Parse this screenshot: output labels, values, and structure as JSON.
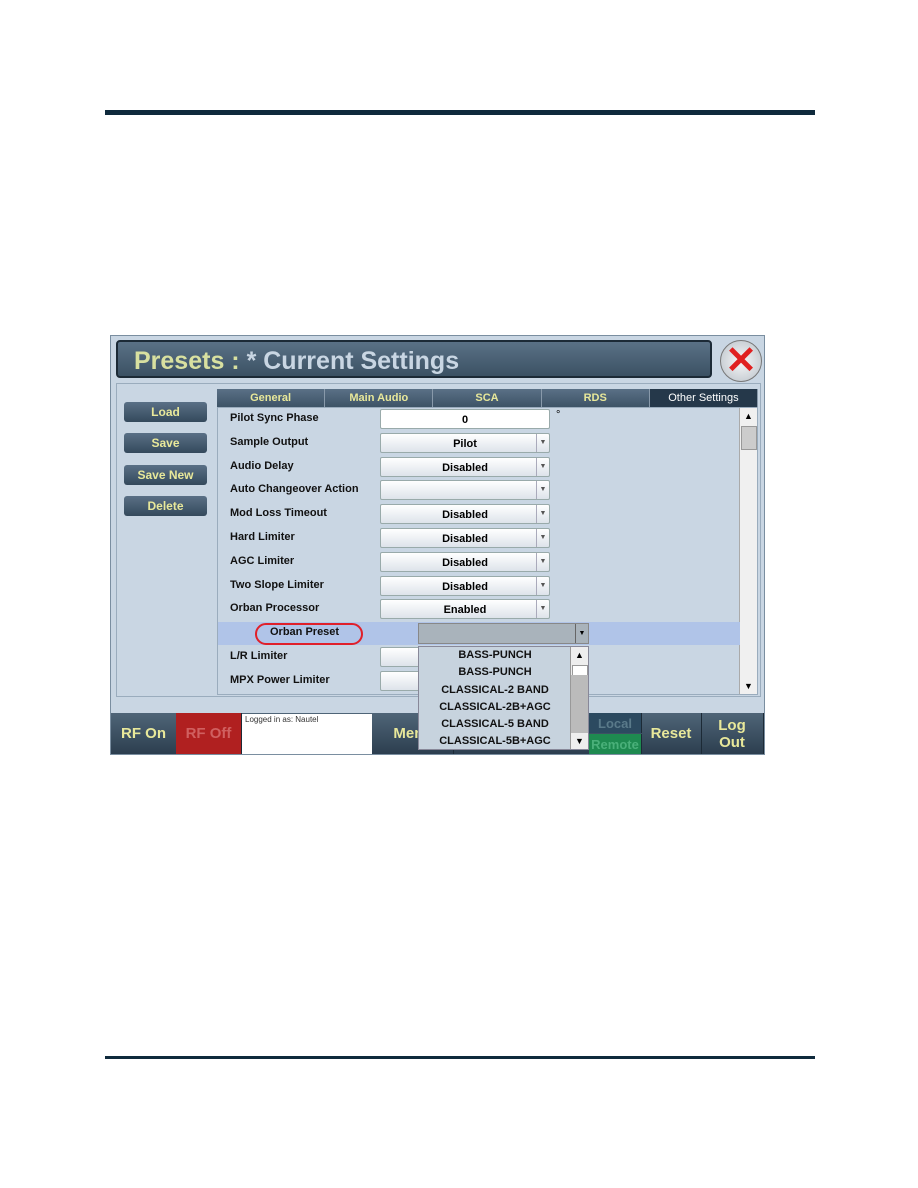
{
  "title": {
    "prefix": "Presets :",
    "rest": "*  Current Settings"
  },
  "side_buttons": [
    "Load",
    "Save",
    "Save New",
    "Delete"
  ],
  "tabs": [
    {
      "label": "General"
    },
    {
      "label": "Main Audio"
    },
    {
      "label": "SCA"
    },
    {
      "label": "RDS"
    },
    {
      "label": "Other Settings",
      "active": true
    }
  ],
  "settings": [
    {
      "label": "Pilot Sync Phase",
      "value": "0",
      "type": "input",
      "unit": "°"
    },
    {
      "label": "Sample Output",
      "value": "Pilot",
      "type": "select"
    },
    {
      "label": "Audio Delay",
      "value": "Disabled",
      "type": "select"
    },
    {
      "label": "Auto Changeover Action",
      "value": "",
      "type": "select"
    },
    {
      "label": "Mod Loss Timeout",
      "value": "Disabled",
      "type": "select"
    },
    {
      "label": "Hard Limiter",
      "value": "Disabled",
      "type": "select"
    },
    {
      "label": "AGC Limiter",
      "value": "Disabled",
      "type": "select"
    },
    {
      "label": "Two Slope Limiter",
      "value": "Disabled",
      "type": "select"
    },
    {
      "label": "Orban Processor",
      "value": "Enabled",
      "type": "select"
    },
    {
      "label": "Orban Preset",
      "value": "",
      "type": "select"
    },
    {
      "label": "L/R Limiter",
      "value": "",
      "type": "select"
    },
    {
      "label": "MPX Power Limiter",
      "value": "",
      "type": "select"
    }
  ],
  "dropdown_options": [
    "BASS-PUNCH",
    "BASS-PUNCH",
    "CLASSICAL-2 BAND",
    "CLASSICAL-2B+AGC",
    "CLASSICAL-5 BAND",
    "CLASSICAL-5B+AGC"
  ],
  "bottom": {
    "rf_on": "RF On",
    "rf_off": "RF Off",
    "logged_in": "Logged in as: Nautel",
    "menu": "Menu",
    "local": "Local",
    "remote": "Remote",
    "reset": "Reset",
    "logout": "Log Out"
  },
  "colors": {
    "accent_text": "#e8e89a",
    "highlight_oval": "#e0202a",
    "rf_off": "#b02020",
    "rule": "#0f2a3c"
  }
}
